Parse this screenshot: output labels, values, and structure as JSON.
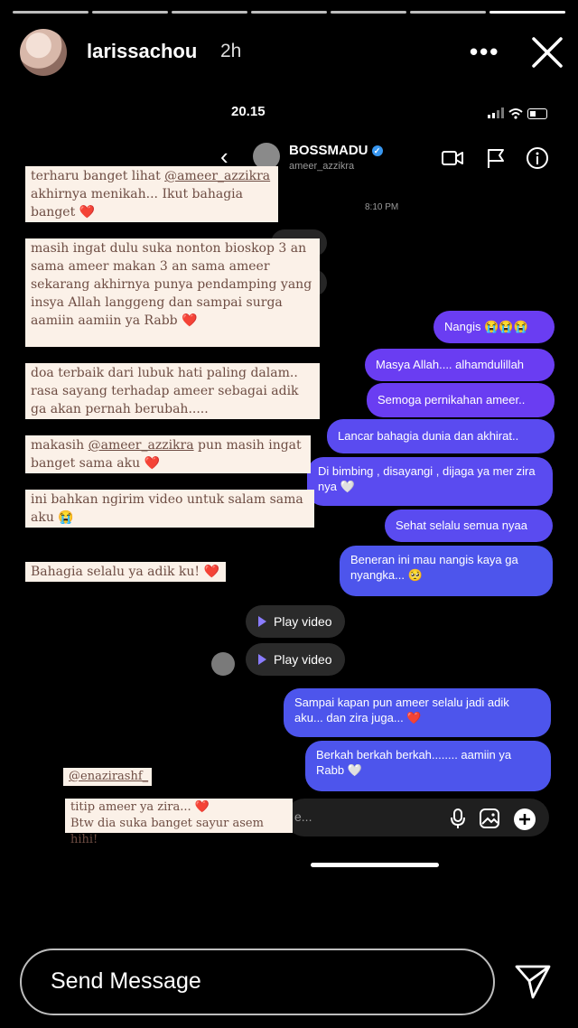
{
  "story": {
    "username": "larissachou",
    "time": "2h",
    "menu_icon": "more-dots-icon",
    "close_icon": "close-icon",
    "progress_segments": 7,
    "active_segment": 7
  },
  "screenshot": {
    "clock": "20.15",
    "chat": {
      "name": "BOSSMADU",
      "handle": "ameer_azzikra",
      "timestamp": "8:10 PM"
    },
    "messages": [
      {
        "text": "Nangis 😭😭😭"
      },
      {
        "text": "Masya Allah.... alhamdulillah"
      },
      {
        "text": "Semoga pernikahan ameer.."
      },
      {
        "text": "Lancar bahagia dunia dan akhirat.."
      },
      {
        "text": "Di bimbing , disayangi , dijaga ya mer zira nya 🤍"
      },
      {
        "text": "Sehat selalu semua nyaa"
      },
      {
        "text": "Beneran ini mau nangis kaya ga nyangka... 🥺"
      },
      {
        "text": "Sampai kapan pun ameer selalu jadi adik aku... dan zira juga... ❤️"
      },
      {
        "text": "Berkah berkah berkah........ aamiin ya Rabb 🤍"
      }
    ],
    "video_label": "Play video",
    "input_placeholder_fragment": "e..."
  },
  "notes": {
    "n1": {
      "pre": "terharu banget lihat ",
      "mention": "@ameer_azzikra",
      "post": " akhirnya menikah... Ikut bahagia banget",
      "heart": "❤️"
    },
    "n2": {
      "text": "masih ingat dulu suka nonton bioskop 3 an sama ameer makan 3 an sama ameer sekarang akhirnya punya pendamping yang insya Allah langgeng dan sampai surga aamiin aamiin ya Rabb",
      "heart": "❤️"
    },
    "n3": {
      "text": "doa terbaik dari lubuk hati paling dalam.. rasa sayang terhadap ameer sebagai adik ga akan pernah berubah....."
    },
    "n4": {
      "pre": "makasih ",
      "mention": "@ameer_azzikra",
      "post": " pun masih ingat banget sama aku",
      "heart": "❤️"
    },
    "n5": {
      "text": "ini bahkan ngirim video untuk salam sama aku 😭"
    },
    "n6": {
      "text": "Bahagia selalu ya adik ku!",
      "heart": "❤️"
    },
    "n7": {
      "mention": "@enazirashf_"
    },
    "n8": {
      "text": "titip ameer ya zira...",
      "heart": "❤️",
      "line2": "Btw dia suka banget sayur asem hihi!"
    }
  },
  "footer": {
    "send_placeholder": "Send Message",
    "send_icon": "paper-plane-icon"
  }
}
